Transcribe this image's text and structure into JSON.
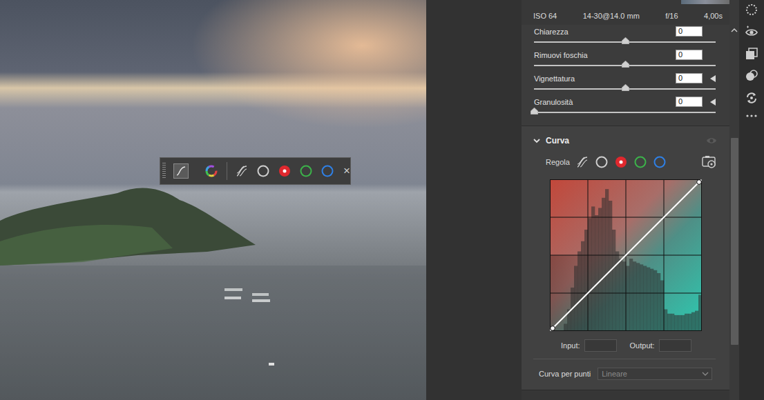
{
  "toolbar": {
    "tools": [
      {
        "kind": "curve",
        "selected": true
      },
      {
        "kind": "color-wheel",
        "selected": false
      }
    ],
    "channels": [
      {
        "kind": "parametric",
        "selected": false,
        "color": "#d0d0d0"
      },
      {
        "kind": "ring",
        "selected": false,
        "color": "#cfcfcf"
      },
      {
        "kind": "ring",
        "selected": true,
        "color": "#e0282e"
      },
      {
        "kind": "ring",
        "selected": false,
        "color": "#3cb34a"
      },
      {
        "kind": "ring",
        "selected": false,
        "color": "#2f80e6"
      }
    ],
    "close": "×"
  },
  "camera_info": [
    "ISO 64",
    "14-30@14.0 mm",
    "f/16",
    "4,00s"
  ],
  "sliders": [
    {
      "label": "Chiarezza",
      "value": "0",
      "level": 0.5,
      "has_reset": false
    },
    {
      "label": "Rimuovi foschia",
      "value": "0",
      "level": 0.5,
      "has_reset": false
    },
    {
      "label": "Vignettatura",
      "value": "0",
      "level": 0.5,
      "has_reset": true
    },
    {
      "label": "Granulosità",
      "value": "0",
      "level": 0.0,
      "has_reset": true
    }
  ],
  "curve_panel": {
    "title": "Curva",
    "expanded": true,
    "adjust_label": "Regola",
    "channels": [
      {
        "kind": "parametric",
        "selected": false,
        "color": "#d0d0d0"
      },
      {
        "kind": "ring",
        "selected": false,
        "color": "#cfcfcf"
      },
      {
        "kind": "ring",
        "selected": true,
        "color": "#e0282e"
      },
      {
        "kind": "ring",
        "selected": false,
        "color": "#3cb34a"
      },
      {
        "kind": "ring",
        "selected": false,
        "color": "#2f80e6"
      }
    ],
    "histogram": [
      0,
      0,
      0,
      0,
      0.05,
      0.15,
      0.3,
      0.45,
      0.55,
      0.62,
      0.7,
      0.78,
      0.86,
      0.8,
      0.85,
      0.92,
      0.98,
      0.9,
      0.7,
      0.55,
      0.5,
      0.48,
      0.45,
      0.5,
      0.48,
      0.47,
      0.46,
      0.45,
      0.44,
      0.43,
      0.42,
      0.4,
      0.35,
      0.15,
      0.12,
      0.12,
      0.11,
      0.11,
      0.11,
      0.12,
      0.12,
      0.13,
      0.14,
      0.25
    ],
    "points": [
      [
        0,
        0
      ],
      [
        255,
        255
      ]
    ],
    "input_label": "Input:",
    "input_value": "",
    "output_label": "Output:",
    "output_value": "",
    "point_curve_label": "Curva per punti",
    "point_curve_value": "Lineare",
    "point_curve_disabled": true
  }
}
